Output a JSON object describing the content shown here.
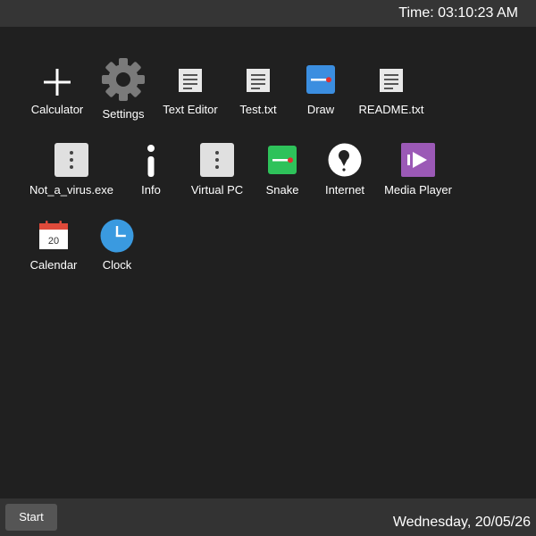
{
  "topbar": {
    "time": "Time: 03:10:23 AM"
  },
  "desktop": {
    "icons": [
      {
        "label": "Calculator",
        "icon": "plus-icon"
      },
      {
        "label": "Settings",
        "icon": "gear-icon"
      },
      {
        "label": "Text Editor",
        "icon": "document-icon"
      },
      {
        "label": "Test.txt",
        "icon": "document-icon"
      },
      {
        "label": "Draw",
        "icon": "draw-icon"
      },
      {
        "label": "README.txt",
        "icon": "document-icon"
      },
      {
        "label": "Not_a_virus.exe",
        "icon": "more-vertical-icon"
      },
      {
        "label": "Info",
        "icon": "info-icon"
      },
      {
        "label": "Virtual PC",
        "icon": "more-vertical-icon"
      },
      {
        "label": "Snake",
        "icon": "snake-icon"
      },
      {
        "label": "Internet",
        "icon": "globe-icon"
      },
      {
        "label": "Media Player",
        "icon": "play-icon"
      },
      {
        "label": "Calendar",
        "icon": "calendar-icon",
        "day": "20"
      },
      {
        "label": "Clock",
        "icon": "clock-icon"
      }
    ]
  },
  "taskbar": {
    "start_label": "Start",
    "date": "Wednesday, 20/05/26"
  },
  "colors": {
    "desktop_bg": "#202020",
    "topbar_bg": "#353535",
    "taskbar_bg": "#333333",
    "draw_blue": "#3b8ee0",
    "snake_green": "#2ec25a",
    "media_purple": "#9b59b6",
    "clock_blue": "#3a9ae0",
    "calendar_red": "#e04a3a"
  }
}
